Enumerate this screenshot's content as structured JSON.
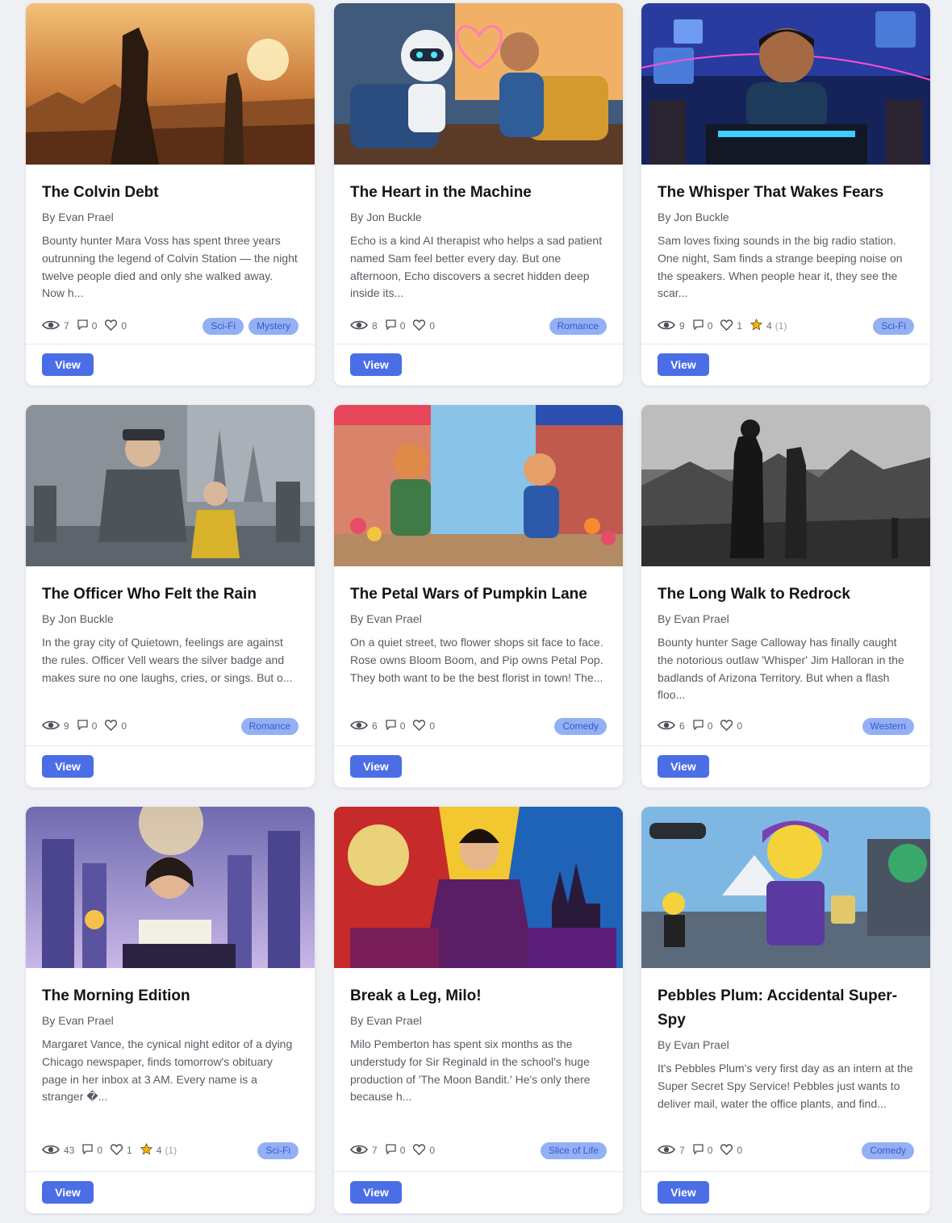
{
  "icons": {
    "views": "eye-icon",
    "comments": "comment-icon",
    "likes": "heart-icon",
    "rating": "star-icon"
  },
  "colors": {
    "accent": "#4b6ee6",
    "tag_bg": "#93b0f5",
    "tag_text": "#3858c7",
    "star": "#f5b800"
  },
  "stories": [
    {
      "title": "The Colvin Debt",
      "author": "By Evan Prael",
      "description": "Bounty hunter Mara Voss has spent three years outrunning the legend of Colvin Station — the night twelve people died and only she walked away. Now h...",
      "views": "7",
      "comments": "0",
      "likes": "0",
      "rating": "",
      "rating_count": "",
      "tags": [
        "Sci-Fi",
        "Mystery"
      ],
      "view_label": "View"
    },
    {
      "title": "The Heart in the Machine",
      "author": "By Jon Buckle",
      "description": "Echo is a kind AI therapist who helps a sad patient named Sam feel better every day. But one afternoon, Echo discovers a secret hidden deep inside its...",
      "views": "8",
      "comments": "0",
      "likes": "0",
      "rating": "",
      "rating_count": "",
      "tags": [
        "Romance"
      ],
      "view_label": "View"
    },
    {
      "title": "The Whisper That Wakes Fears",
      "author": "By Jon Buckle",
      "description": "Sam loves fixing sounds in the big radio station. One night, Sam finds a strange beeping noise on the speakers. When people hear it, they see the scar...",
      "views": "9",
      "comments": "0",
      "likes": "1",
      "rating": "4",
      "rating_count": "(1)",
      "tags": [
        "Sci-Fi"
      ],
      "view_label": "View"
    },
    {
      "title": "The Officer Who Felt the Rain",
      "author": "By Jon Buckle",
      "description": "In the gray city of Quietown, feelings are against the rules. Officer Vell wears the silver badge and makes sure no one laughs, cries, or sings. But o...",
      "views": "9",
      "comments": "0",
      "likes": "0",
      "rating": "",
      "rating_count": "",
      "tags": [
        "Romance"
      ],
      "view_label": "View"
    },
    {
      "title": "The Petal Wars of Pumpkin Lane",
      "author": "By Evan Prael",
      "description": "On a quiet street, two flower shops sit face to face. Rose owns Bloom Boom, and Pip owns Petal Pop. They both want to be the best florist in town! The...",
      "views": "6",
      "comments": "0",
      "likes": "0",
      "rating": "",
      "rating_count": "",
      "tags": [
        "Comedy"
      ],
      "view_label": "View"
    },
    {
      "title": "The Long Walk to Redrock",
      "author": "By Evan Prael",
      "description": "Bounty hunter Sage Calloway has finally caught the notorious outlaw 'Whisper' Jim Halloran in the badlands of Arizona Territory. But when a flash floo...",
      "views": "6",
      "comments": "0",
      "likes": "0",
      "rating": "",
      "rating_count": "",
      "tags": [
        "Western"
      ],
      "view_label": "View"
    },
    {
      "title": "The Morning Edition",
      "author": "By Evan Prael",
      "description": "Margaret Vance, the cynical night editor of a dying Chicago newspaper, finds tomorrow's obituary page in her inbox at 3 AM. Every name is a stranger �...",
      "views": "43",
      "comments": "0",
      "likes": "1",
      "rating": "4",
      "rating_count": "(1)",
      "tags": [
        "Sci-Fi"
      ],
      "view_label": "View"
    },
    {
      "title": "Break a Leg, Milo!",
      "author": "By Evan Prael",
      "description": "Milo Pemberton has spent six months as the understudy for Sir Reginald in the school's huge production of 'The Moon Bandit.' He's only there because h...",
      "views": "7",
      "comments": "0",
      "likes": "0",
      "rating": "",
      "rating_count": "",
      "tags": [
        "Slice of Life"
      ],
      "view_label": "View"
    },
    {
      "title": "Pebbles Plum: Accidental Super-Spy",
      "author": "By Evan Prael",
      "description": "It's Pebbles Plum's very first day as an intern at the Super Secret Spy Service! Pebbles just wants to deliver mail, water the office plants, and find...",
      "views": "7",
      "comments": "0",
      "likes": "0",
      "rating": "",
      "rating_count": "",
      "tags": [
        "Comedy"
      ],
      "view_label": "View"
    }
  ]
}
